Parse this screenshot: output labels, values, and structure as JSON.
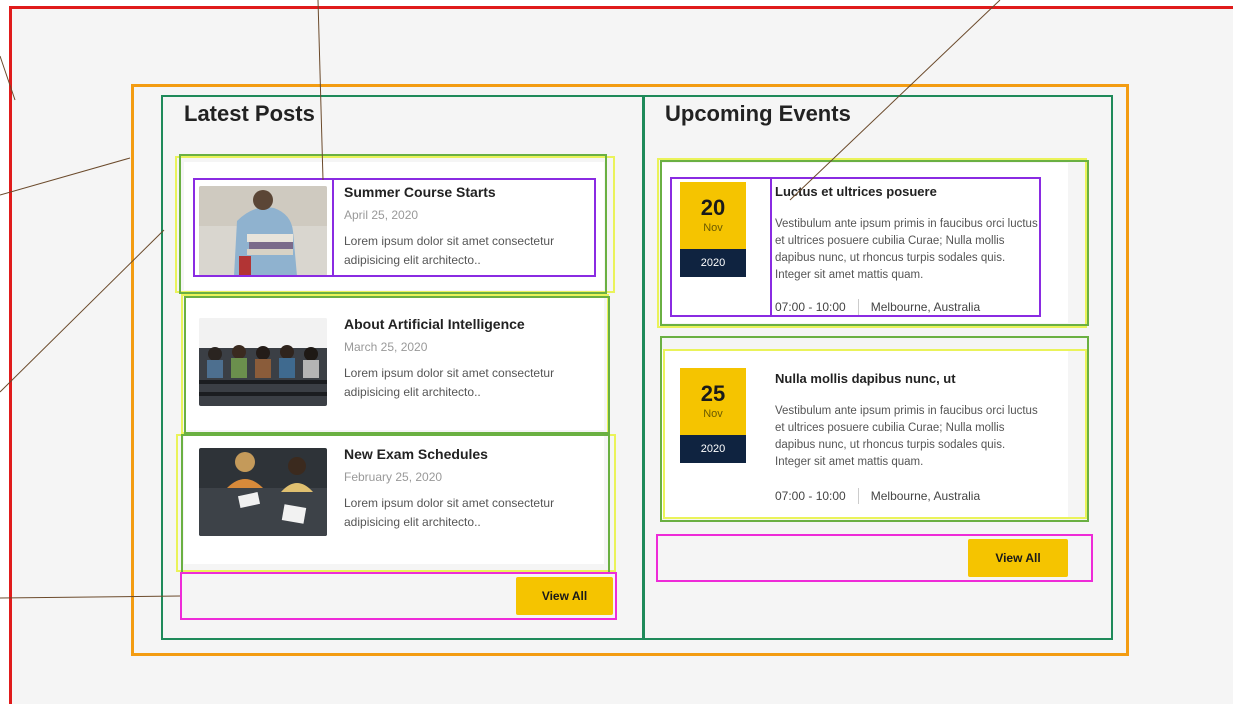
{
  "latest_posts": {
    "title": "Latest Posts",
    "view_all_label": "View All",
    "items": [
      {
        "title": "Summer Course Starts",
        "date": "April 25, 2020",
        "excerpt": "Lorem ipsum dolor sit amet consectetur adipisicing elit architecto..",
        "image": "student-with-books"
      },
      {
        "title": "About Artificial Intelligence",
        "date": "March 25, 2020",
        "excerpt": "Lorem ipsum dolor sit amet consectetur adipisicing elit architecto..",
        "image": "lecture-hall-audience"
      },
      {
        "title": "New Exam Schedules",
        "date": "February 25, 2020",
        "excerpt": "Lorem ipsum dolor sit amet consectetur adipisicing elit architecto..",
        "image": "students-studying-table"
      }
    ]
  },
  "upcoming_events": {
    "title": "Upcoming Events",
    "view_all_label": "View All",
    "items": [
      {
        "day": "20",
        "month": "Nov",
        "year": "2020",
        "title": "Luctus et ultrices posuere",
        "description": "Vestibulum ante ipsum primis in faucibus orci luctus et ultrices posuere cubilia Curae; Nulla mollis dapibus nunc, ut rhoncus turpis sodales quis. Integer sit amet mattis quam.",
        "time": "07:00 - 10:00",
        "location": "Melbourne, Australia"
      },
      {
        "day": "25",
        "month": "Nov",
        "year": "2020",
        "title": "Nulla mollis dapibus nunc, ut",
        "description": "Vestibulum ante ipsum primis in faucibus orci luctus et ultrices posuere cubilia Curae; Nulla mollis dapibus nunc, ut rhoncus turpis sodales quis. Integer sit amet mattis quam.",
        "time": "07:00 - 10:00",
        "location": "Melbourne, Australia"
      }
    ]
  },
  "colors": {
    "accent": "#f5c400",
    "navy": "#0f2340",
    "page_background": "#f5f5f5",
    "annotation_red": "#e01b1b",
    "annotation_orange": "#f39c12",
    "annotation_green": "#1f8a5a",
    "annotation_purple": "#8a2be2",
    "annotation_magenta": "#ee2bd8",
    "annotation_yellow": "#eaf35a"
  }
}
